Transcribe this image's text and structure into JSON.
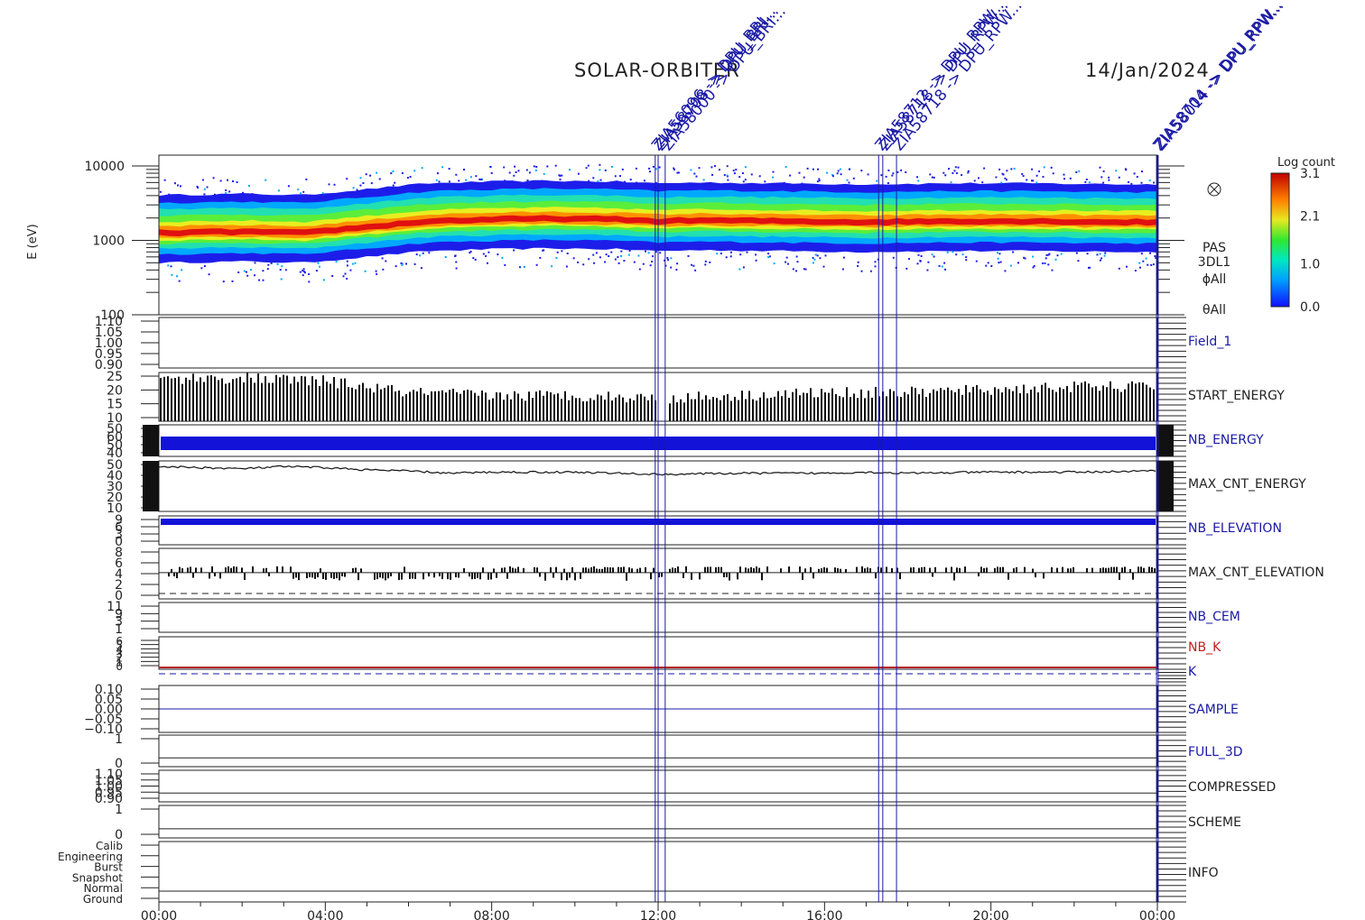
{
  "header": {
    "mission": "SOLAR-ORBITER",
    "date": "14/Jan/2024"
  },
  "chart_data": {
    "type": "spectrogram + multi-panel time series",
    "time_axis": {
      "range": [
        "00:00",
        "24:00"
      ],
      "tick_labels": [
        "00:00",
        "04:00",
        "08:00",
        "12:00",
        "16:00",
        "20:00",
        "00:00"
      ]
    },
    "markers": {
      "label_prefix": "ZIA",
      "times_hours": [
        11.93,
        12.0,
        12.17,
        17.3,
        17.4,
        17.73,
        23.98,
        24.02
      ],
      "labels": [
        "ZIA56096 -> DPU_BRI...",
        "ZIA58708 -> DPU_BRI...",
        "ZIA58000 -> DPU_BRI...",
        "ZIA58712 -> DPU_RPW...",
        "ZIA58718 -> DPU_RPW...",
        "ZIA58718 -> DPU_RPW...",
        "ZIA58704 -> DPU_RPW...",
        "ZIA58014 -> DPU_RPW..."
      ]
    },
    "spectrogram": {
      "ylabel": "E (eV)",
      "y_scale": "log",
      "ylim": [
        100,
        14000
      ],
      "y_tick_labels": [
        "10000",
        "1000",
        "100"
      ],
      "right_labels": [
        "PAS",
        "3DL1",
        "ϕAll",
        "θAll"
      ],
      "colorbar": {
        "title": "Log count",
        "range": [
          0.0,
          3.1
        ],
        "tick_labels": [
          "3.1",
          "2.1",
          "1.0",
          "0.0"
        ]
      },
      "peak_energy_eV": {
        "t_hours": [
          0,
          2,
          3.5,
          5,
          6.5,
          8,
          9.5,
          11,
          12,
          13,
          15,
          17,
          19,
          21,
          23,
          24
        ],
        "values": [
          1250,
          1300,
          1250,
          1500,
          1800,
          1900,
          1950,
          1900,
          1800,
          1850,
          1800,
          1750,
          1800,
          1800,
          1750,
          1750
        ]
      }
    },
    "panels": [
      {
        "name": "Field_1",
        "label_color": "#1a1aa6",
        "y_tick_labels": [
          "1.10",
          "1.05",
          "1.00",
          "0.95",
          "0.90"
        ]
      },
      {
        "name": "START_ENERGY",
        "label_color": "#222222",
        "y_tick_labels": [
          "25",
          "20",
          "15",
          "10"
        ],
        "ylim": [
          8,
          25
        ],
        "series_t_hours": [
          0,
          2,
          4,
          6,
          8,
          10,
          12,
          14,
          16,
          18,
          20,
          22,
          24
        ],
        "series_values": [
          23,
          23,
          22,
          18,
          17,
          17,
          16,
          17,
          18,
          18,
          19,
          20,
          20
        ]
      },
      {
        "name": "NB_ENERGY",
        "label_color": "#1a1aa6",
        "y_tick_labels": [
          "50",
          "60",
          "50",
          "40"
        ]
      },
      {
        "name": "MAX_CNT_ENERGY",
        "label_color": "#222222",
        "y_tick_labels": [
          "50",
          "40",
          "30",
          "20",
          "10"
        ],
        "ylim": [
          7,
          52
        ],
        "series_t_hours": [
          0,
          1,
          2,
          3,
          4,
          5,
          6,
          7,
          8,
          10,
          12,
          14,
          16,
          17,
          18,
          20,
          22,
          24
        ],
        "series_values": [
          47,
          46,
          45,
          47,
          46,
          44,
          43,
          41,
          42,
          42,
          40,
          41,
          41,
          42,
          41,
          42,
          42,
          43
        ]
      },
      {
        "name": "NB_ELEVATION",
        "label_color": "#1a1aa6",
        "y_tick_labels": [
          "9",
          "6",
          "3",
          "0"
        ]
      },
      {
        "name": "MAX_CNT_ELEVATION",
        "label_color": "#222222",
        "y_tick_labels": [
          "8",
          "6",
          "4",
          "2",
          "0"
        ]
      },
      {
        "name": "NB_CEM",
        "label_color": "#1a1aa6",
        "y_tick_labels": [
          "11",
          "9",
          "3",
          "1"
        ]
      },
      {
        "name": "NB_K",
        "label_color": "#c41e1e",
        "y_tick_labels": [
          "6",
          "5",
          "4",
          "3",
          "2",
          "1",
          "0"
        ]
      },
      {
        "name": "K",
        "label_color": "#1a1aa6",
        "y_tick_labels": []
      },
      {
        "name": "SAMPLE",
        "label_color": "#1a1aa6",
        "y_tick_labels": [
          "0.10",
          "0.05",
          "0.00",
          "−0.05",
          "−0.10"
        ]
      },
      {
        "name": "FULL_3D",
        "label_color": "#1a1aa6",
        "y_tick_labels": [
          "1",
          "0"
        ]
      },
      {
        "name": "COMPRESSED",
        "label_color": "#222222",
        "y_tick_labels": [
          "1.10",
          "1.05",
          "1.00",
          "0.95",
          "0.90"
        ]
      },
      {
        "name": "SCHEME",
        "label_color": "#222222",
        "y_tick_labels": [
          "1",
          "0"
        ]
      },
      {
        "name": "INFO",
        "label_color": "#222222",
        "y_tick_labels": [
          "Calib",
          "Engineering",
          "Burst",
          "Snapshot",
          "Normal",
          "Ground"
        ]
      }
    ]
  }
}
